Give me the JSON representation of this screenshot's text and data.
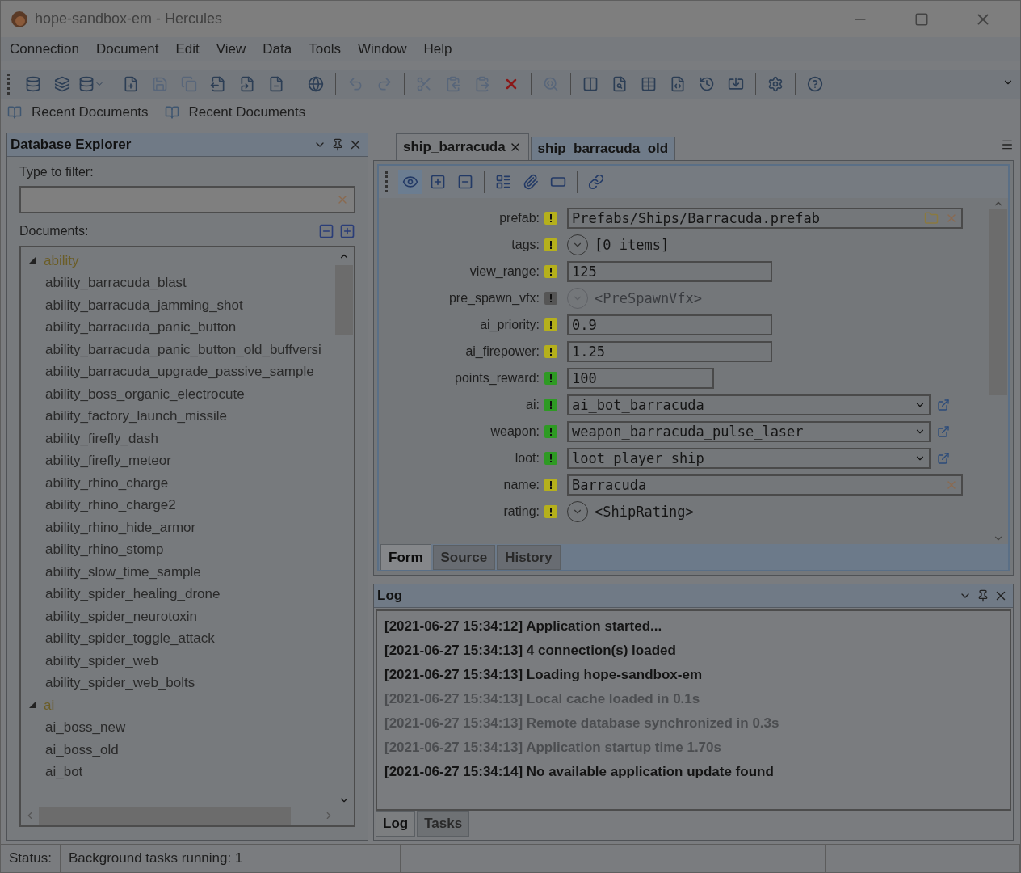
{
  "window": {
    "title": "hope-sandbox-em - Hercules"
  },
  "menu": [
    "Connection",
    "Document",
    "Edit",
    "View",
    "Data",
    "Tools",
    "Window",
    "Help"
  ],
  "toolbar": [
    {
      "kind": "db-add",
      "disabled": false
    },
    {
      "kind": "db-stack",
      "disabled": false
    },
    {
      "kind": "db-menu",
      "disabled": false
    },
    {
      "kind": "sep"
    },
    {
      "kind": "file-add",
      "disabled": false
    },
    {
      "kind": "save",
      "disabled": true
    },
    {
      "kind": "save-all",
      "disabled": true
    },
    {
      "kind": "file-out",
      "disabled": false
    },
    {
      "kind": "file-link",
      "disabled": false
    },
    {
      "kind": "file-remove",
      "disabled": false
    },
    {
      "kind": "sep"
    },
    {
      "kind": "globe",
      "disabled": false
    },
    {
      "kind": "sep"
    },
    {
      "kind": "undo",
      "disabled": true
    },
    {
      "kind": "redo",
      "disabled": true
    },
    {
      "kind": "sep"
    },
    {
      "kind": "cut",
      "disabled": true
    },
    {
      "kind": "copy",
      "disabled": true
    },
    {
      "kind": "paste",
      "disabled": true
    },
    {
      "kind": "delete",
      "disabled": false
    },
    {
      "kind": "sep"
    },
    {
      "kind": "find",
      "disabled": true
    },
    {
      "kind": "sep"
    },
    {
      "kind": "compare",
      "disabled": false
    },
    {
      "kind": "search",
      "disabled": false
    },
    {
      "kind": "table",
      "disabled": false
    },
    {
      "kind": "script",
      "disabled": false
    },
    {
      "kind": "history",
      "disabled": false
    },
    {
      "kind": "import",
      "disabled": false
    },
    {
      "kind": "sep"
    },
    {
      "kind": "settings",
      "disabled": false
    },
    {
      "kind": "sep"
    },
    {
      "kind": "help",
      "disabled": false
    }
  ],
  "recent": [
    "Recent Documents",
    "Recent Documents"
  ],
  "explorer": {
    "title": "Database Explorer",
    "filter_label": "Type to filter:",
    "documents_label": "Documents:",
    "tree": [
      {
        "label": "ability",
        "expanded": true,
        "children": [
          "ability_barracuda_blast",
          "ability_barracuda_jamming_shot",
          "ability_barracuda_panic_button",
          "ability_barracuda_panic_button_old_buffversi",
          "ability_barracuda_upgrade_passive_sample",
          "ability_boss_organic_electrocute",
          "ability_factory_launch_missile",
          "ability_firefly_dash",
          "ability_firefly_meteor",
          "ability_rhino_charge",
          "ability_rhino_charge2",
          "ability_rhino_hide_armor",
          "ability_rhino_stomp",
          "ability_slow_time_sample",
          "ability_spider_healing_drone",
          "ability_spider_neurotoxin",
          "ability_spider_toggle_attack",
          "ability_spider_web",
          "ability_spider_web_bolts"
        ]
      },
      {
        "label": "ai",
        "expanded": true,
        "children": [
          "ai_boss_new",
          "ai_boss_old",
          "ai_bot"
        ]
      }
    ]
  },
  "tabs": [
    {
      "label": "ship_barracuda",
      "selected": true
    },
    {
      "label": "ship_barracuda_old",
      "selected": false
    }
  ],
  "form": {
    "tools": [
      {
        "kind": "eye",
        "selected": true
      },
      {
        "kind": "expand",
        "selected": false
      },
      {
        "kind": "collapse",
        "selected": false
      },
      {
        "kind": "sep"
      },
      {
        "kind": "layout",
        "selected": false
      },
      {
        "kind": "attach",
        "selected": false
      },
      {
        "kind": "frame",
        "selected": false
      },
      {
        "kind": "sep"
      },
      {
        "kind": "link",
        "selected": false
      }
    ],
    "fields": [
      {
        "label": "prefab:",
        "color": "#b5b01c",
        "kind": "path",
        "value": "Prefabs/Ships/Barracuda.prefab"
      },
      {
        "label": "tags:",
        "color": "#b5b01c",
        "kind": "object",
        "value": "[0 items]",
        "disabled": false
      },
      {
        "label": "view_range:",
        "color": "#b5b01c",
        "kind": "short",
        "value": "125"
      },
      {
        "label": "pre_spawn_vfx:",
        "color": "#555555",
        "kind": "object",
        "value": "<PreSpawnVfx>",
        "disabled": true
      },
      {
        "label": "ai_priority:",
        "color": "#b5b01c",
        "kind": "short",
        "value": "0.9"
      },
      {
        "label": "ai_firepower:",
        "color": "#b5b01c",
        "kind": "short",
        "value": "1.25"
      },
      {
        "label": "points_reward:",
        "color": "#2e9a23",
        "kind": "tiny",
        "value": "100"
      },
      {
        "label": "ai:",
        "color": "#2e9a23",
        "kind": "combo",
        "value": "ai_bot_barracuda"
      },
      {
        "label": "weapon:",
        "color": "#2e9a23",
        "kind": "combo",
        "value": "weapon_barracuda_pulse_laser"
      },
      {
        "label": "loot:",
        "color": "#2e9a23",
        "kind": "combo",
        "value": "loot_player_ship"
      },
      {
        "label": "name:",
        "color": "#b5b01c",
        "kind": "text",
        "value": "Barracuda"
      },
      {
        "label": "rating:",
        "color": "#b5b01c",
        "kind": "object",
        "value": "<ShipRating>",
        "disabled": false
      }
    ],
    "view_tabs": [
      {
        "label": "Form",
        "selected": true
      },
      {
        "label": "Source",
        "selected": false
      },
      {
        "label": "History",
        "selected": false
      }
    ]
  },
  "log": {
    "title": "Log",
    "lines": [
      {
        "text": "[2021-06-27 15:34:12] Application started...",
        "kind": "info"
      },
      {
        "text": "[2021-06-27 15:34:13] 4 connection(s) loaded",
        "kind": "info"
      },
      {
        "text": "[2021-06-27 15:34:13] Loading hope-sandbox-em",
        "kind": "info"
      },
      {
        "text": "[2021-06-27 15:34:13] Local cache loaded in 0.1s",
        "kind": "debug"
      },
      {
        "text": "[2021-06-27 15:34:13] Remote database synchronized in 0.3s",
        "kind": "debug"
      },
      {
        "text": "[2021-06-27 15:34:13] Application startup time 1.70s",
        "kind": "debug"
      },
      {
        "text": "[2021-06-27 15:34:14] No available application update found",
        "kind": "info"
      }
    ],
    "tabs": [
      {
        "label": "Log",
        "selected": true
      },
      {
        "label": "Tasks",
        "selected": false
      }
    ]
  },
  "status": {
    "label": "Status:",
    "text": "Background tasks running: 1"
  }
}
